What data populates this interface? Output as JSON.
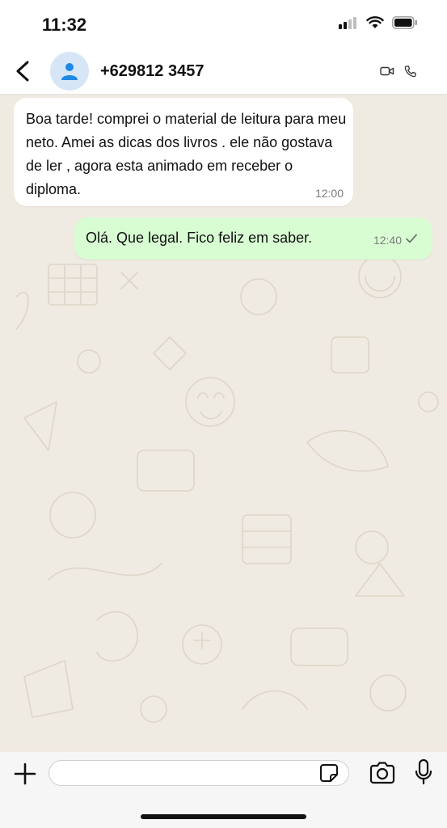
{
  "status_bar": {
    "time": "11:32"
  },
  "header": {
    "contact_name": "+629812 3457",
    "icons": [
      "back-chevron-icon",
      "person-icon",
      "video-camera-icon",
      "phone-icon"
    ]
  },
  "messages": [
    {
      "direction": "incoming",
      "text": "Boa tarde! comprei o material de leitura para meu neto. Amei as dicas dos livros . ele não gostava de ler , agora esta animado em receber o diploma.",
      "time": "12:00"
    },
    {
      "direction": "outgoing",
      "text": "Olá. Que legal. Fico feliz em saber.",
      "time": "12:40",
      "status": "sent-check-icon"
    }
  ],
  "composer": {
    "placeholder": "",
    "icons": [
      "plus-icon",
      "sticker-icon",
      "camera-icon",
      "microphone-icon"
    ]
  },
  "colors": {
    "chat_background": "#efeae2",
    "incoming_bubble": "#ffffff",
    "outgoing_bubble": "#d9fdd3",
    "avatar_bg": "#d6e6f7",
    "avatar_icon": "#1e88e5"
  }
}
